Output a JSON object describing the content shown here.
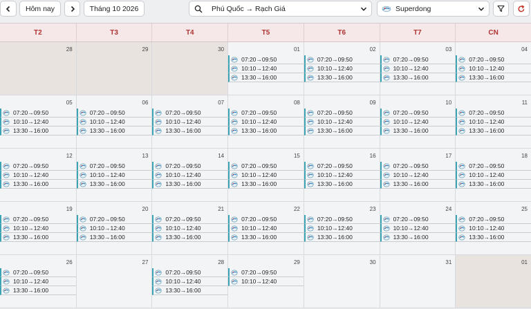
{
  "toolbar": {
    "today_label": "Hôm nay",
    "month_label": "Tháng 10 2026",
    "route_value": "Phú Quốc → Rạch Giá",
    "operator_value": "Superdong"
  },
  "weekdays": [
    "T2",
    "T3",
    "T4",
    "T5",
    "T6",
    "T7",
    "CN"
  ],
  "trip_times": [
    "07:20→09:50",
    "10:10→12:40",
    "13:30→16:00"
  ],
  "days": [
    {
      "num": "28",
      "outside": true,
      "trips": 0
    },
    {
      "num": "29",
      "outside": true,
      "trips": 0
    },
    {
      "num": "30",
      "outside": true,
      "trips": 0
    },
    {
      "num": "01",
      "outside": false,
      "trips": 3
    },
    {
      "num": "02",
      "outside": false,
      "trips": 3
    },
    {
      "num": "03",
      "outside": false,
      "trips": 3
    },
    {
      "num": "04",
      "outside": false,
      "trips": 3
    },
    {
      "num": "05",
      "outside": false,
      "trips": 3
    },
    {
      "num": "06",
      "outside": false,
      "trips": 3
    },
    {
      "num": "07",
      "outside": false,
      "trips": 3
    },
    {
      "num": "08",
      "outside": false,
      "trips": 3
    },
    {
      "num": "09",
      "outside": false,
      "trips": 3
    },
    {
      "num": "10",
      "outside": false,
      "trips": 3
    },
    {
      "num": "11",
      "outside": false,
      "trips": 3
    },
    {
      "num": "12",
      "outside": false,
      "trips": 3
    },
    {
      "num": "13",
      "outside": false,
      "trips": 3
    },
    {
      "num": "14",
      "outside": false,
      "trips": 3
    },
    {
      "num": "15",
      "outside": false,
      "trips": 3
    },
    {
      "num": "16",
      "outside": false,
      "trips": 3
    },
    {
      "num": "17",
      "outside": false,
      "trips": 3
    },
    {
      "num": "18",
      "outside": false,
      "trips": 3
    },
    {
      "num": "19",
      "outside": false,
      "trips": 3
    },
    {
      "num": "20",
      "outside": false,
      "trips": 3
    },
    {
      "num": "21",
      "outside": false,
      "trips": 3
    },
    {
      "num": "22",
      "outside": false,
      "trips": 3
    },
    {
      "num": "23",
      "outside": false,
      "trips": 3
    },
    {
      "num": "24",
      "outside": false,
      "trips": 3
    },
    {
      "num": "25",
      "outside": false,
      "trips": 3
    },
    {
      "num": "26",
      "outside": false,
      "trips": 3
    },
    {
      "num": "27",
      "outside": false,
      "trips": 0
    },
    {
      "num": "28",
      "outside": false,
      "trips": 3
    },
    {
      "num": "29",
      "outside": false,
      "trips": 2
    },
    {
      "num": "30",
      "outside": false,
      "trips": 0
    },
    {
      "num": "31",
      "outside": false,
      "trips": 0
    },
    {
      "num": "01",
      "outside": true,
      "trips": 0
    }
  ],
  "icons": {
    "prev": "chevron-left-icon",
    "next": "chevron-right-icon",
    "search": "search-icon",
    "dropdown": "chevron-down-icon",
    "operator_logo": "superdong-logo-icon",
    "filter": "filter-icon",
    "refresh": "refresh-icon",
    "trip": "ferry-icon"
  },
  "colors": {
    "weekday_text": "#b0342f",
    "header_bg": "#f6e7e9",
    "trip_accent": "#3aa3b4",
    "outside_day_bg": "#e8e3df",
    "refresh_icon": "#c0392b"
  }
}
